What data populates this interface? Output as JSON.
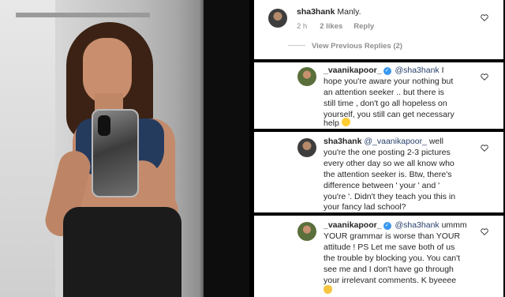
{
  "comments": [
    {
      "username": "sha3hank",
      "text": "Manly.",
      "time": "2 h",
      "likes": "2 likes",
      "reply_label": "Reply",
      "view_replies": "View Previous Replies (2)"
    },
    {
      "username": "_vaanikapoor_",
      "mention": "@sha3hank",
      "lines": [
        " I",
        "hope you're aware your nothing but",
        "an attention seeker .. but there is",
        "still time , don't go all hopeless on",
        "yourself, you still can get necessary",
        "help"
      ],
      "emoji": "smiling-face"
    },
    {
      "username": "sha3hank",
      "mention": "@_vaanikapoor_",
      "lines": [
        " well",
        "you're the one posting 2-3 pictures",
        "every other day so we all know who",
        "the attention seeker is. Btw, there's",
        "difference between ' your ' and '",
        "you're '. Didn't they teach you this in",
        "your fancy lad school?"
      ]
    },
    {
      "username": "_vaanikapoor_",
      "mention": "@sha3hank",
      "lines": [
        " ummm",
        "YOUR  grammar is worse than YOUR",
        "attitude ! PS Let me save both of us",
        "the trouble by blocking you. You can't",
        "see me and I don't have go through",
        "your irrelevant comments. K byeeee"
      ],
      "emoji": "waving-hand"
    }
  ],
  "icons": {
    "verified": "verified-badge-icon",
    "like": "heart-outline-icon"
  },
  "colors": {
    "verified": "#3897f0",
    "mention": "#27406b",
    "meta": "#8e8e8e"
  }
}
